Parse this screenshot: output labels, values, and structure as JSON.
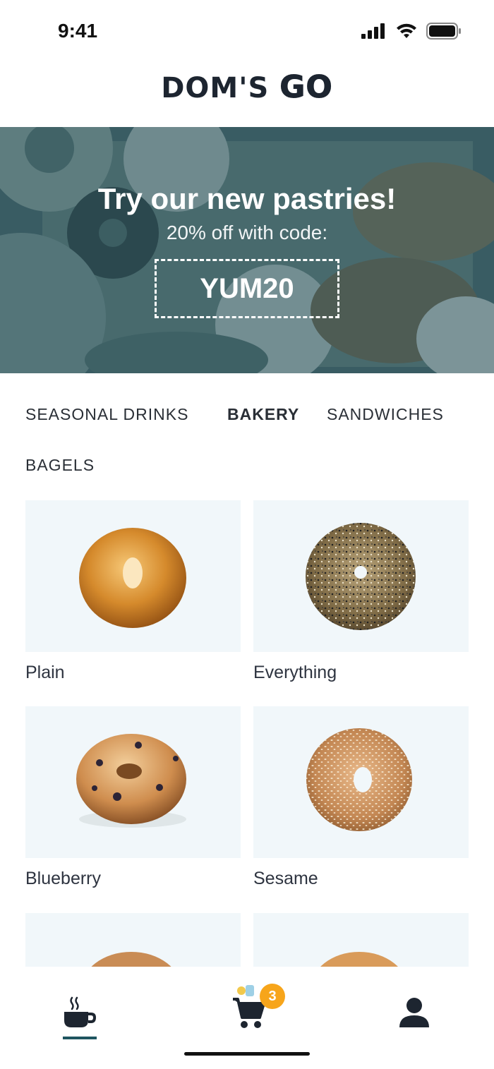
{
  "status_bar": {
    "time": "9:41"
  },
  "header": {
    "logo_main": "DOM'S",
    "logo_go": "GO"
  },
  "banner": {
    "title": "Try our new pastries!",
    "subtitle": "20% off with code:",
    "promo_code": "YUM20"
  },
  "categories": [
    {
      "label": "SEASONAL DRINKS",
      "active": false
    },
    {
      "label": "BAKERY",
      "active": true
    },
    {
      "label": "SANDWICHES",
      "active": false
    },
    {
      "label": "BAGELS",
      "active": false
    }
  ],
  "products": [
    {
      "name": "Plain"
    },
    {
      "name": "Everything"
    },
    {
      "name": "Blueberry"
    },
    {
      "name": "Sesame"
    }
  ],
  "bottom_nav": {
    "items": [
      {
        "icon": "coffee-cup-icon",
        "active": true
      },
      {
        "icon": "cart-icon",
        "active": false
      },
      {
        "icon": "user-icon",
        "active": false
      }
    ],
    "cart_count": "3"
  },
  "colors": {
    "accent": "#1f5560",
    "badge": "#f7a51b",
    "tile_bg": "#f1f7fa"
  }
}
